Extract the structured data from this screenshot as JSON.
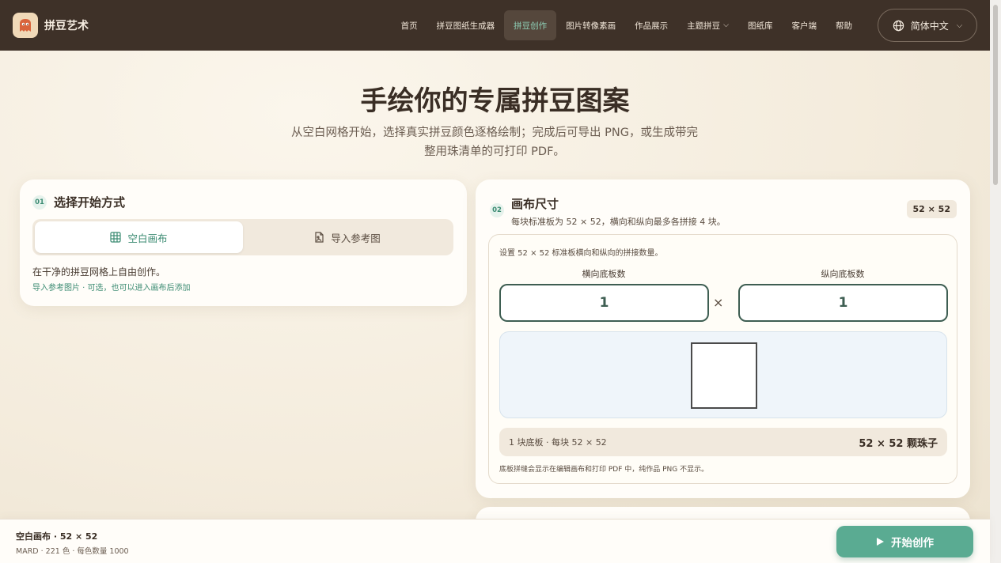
{
  "nav": {
    "brand": "拼豆艺术",
    "items": [
      {
        "label": "首页"
      },
      {
        "label": "拼豆图纸生成器"
      },
      {
        "label": "拼豆创作",
        "active": true
      },
      {
        "label": "图片转像素画"
      },
      {
        "label": "作品展示"
      },
      {
        "label": "主题拼豆",
        "dropdown": true
      },
      {
        "label": "图纸库"
      },
      {
        "label": "客户端"
      },
      {
        "label": "帮助"
      }
    ],
    "language": "简体中文"
  },
  "hero": {
    "title": "手绘你的专属拼豆图案",
    "subtitle_line1": "从空白网格开始，选择真实拼豆颜色逐格绘制；完成后可导出 PNG，或生成带完",
    "subtitle_line2": "整用珠清单的可打印 PDF。"
  },
  "start_mode": {
    "step": "01",
    "title": "选择开始方式",
    "options": [
      {
        "label": "空白画布",
        "icon": "grid-icon",
        "active": true
      },
      {
        "label": "导入参考图",
        "icon": "image-file-icon",
        "active": false
      }
    ],
    "description": "在干净的拼豆网格上自由创作。",
    "hint": "导入参考图片 · 可选，也可以进入画布后添加"
  },
  "canvas_size": {
    "step": "02",
    "title": "画布尺寸",
    "subtitle": "每块标准板为 52 × 52，横向和纵向最多各拼接 4 块。",
    "badge": "52 × 52",
    "settings_desc": "设置 52 × 52 标准板横向和纵向的拼接数量。",
    "horizontal_label": "横向底板数",
    "horizontal_value": "1",
    "times": "×",
    "vertical_label": "纵向底板数",
    "vertical_value": "1",
    "summary_left": "1 块底板 · 每块 52 × 52",
    "summary_right": "52 × 52 颗珠子",
    "note": "底板拼缝会显示在编辑画布和打印 PDF 中，纯作品 PNG 不显示。"
  },
  "bottom_bar": {
    "line1": "空白画布 · 52 × 52",
    "line2": "MARD · 221 色 · 每色数量 1000",
    "start_label": "开始创作"
  },
  "colors": {
    "nav_bg": "#3e3128",
    "accent": "#5aab92",
    "accent_text": "#3b8b72",
    "input_border": "#3e5e52"
  }
}
